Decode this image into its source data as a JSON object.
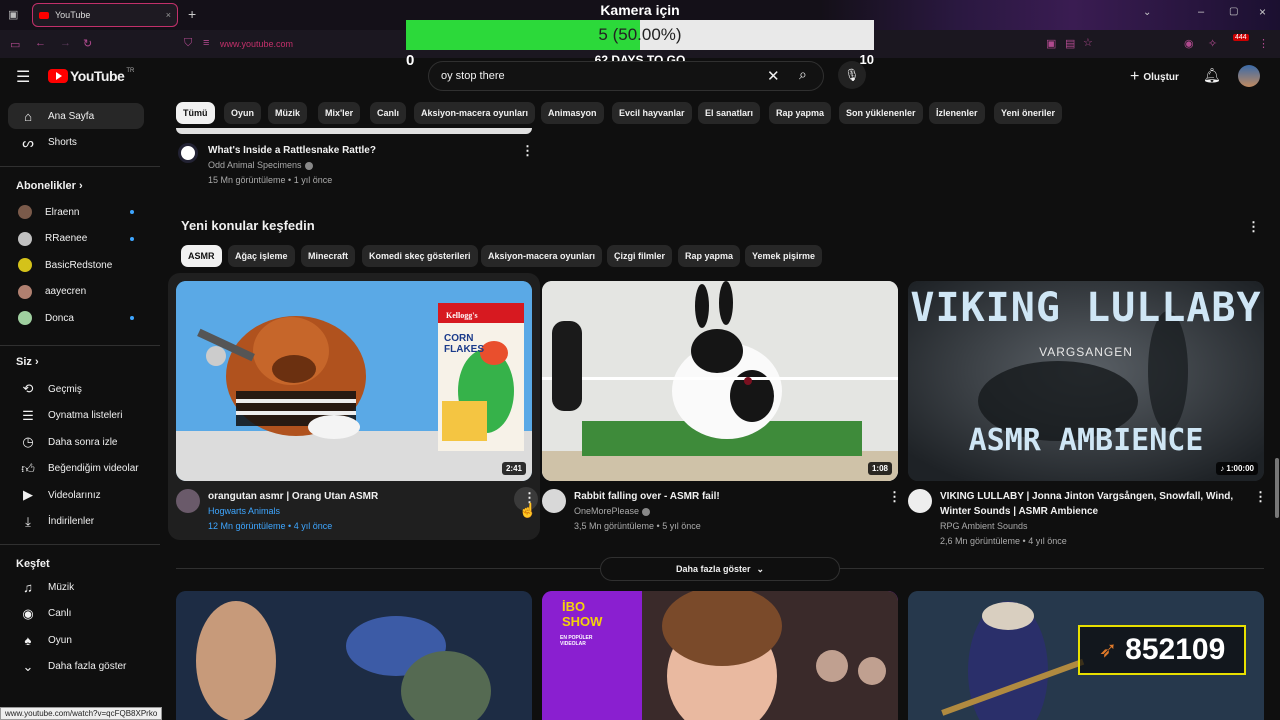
{
  "browser": {
    "tab_title": "YouTube",
    "url": "www.youtube.com",
    "badge_count": "444"
  },
  "overlay": {
    "title": "Kamera için",
    "progress_text": "5 (50.00%)",
    "progress_fraction": 0.5,
    "min": "0",
    "max": "10",
    "days_left": "62 DAYS TO GO"
  },
  "header": {
    "logo_text": "YouTube",
    "logo_sup": "TR",
    "search_value": "oy stop there",
    "create_label": "Oluştur"
  },
  "sidebar": {
    "main": [
      {
        "label": "Ana Sayfa",
        "icon": "home-icon"
      },
      {
        "label": "Shorts",
        "icon": "shorts-icon"
      }
    ],
    "subs_title": "Abonelikler",
    "subs": [
      {
        "label": "Elraenn",
        "color": "#7a5a4a",
        "live": true
      },
      {
        "label": "RRaenee",
        "color": "#c0c0c0",
        "live": true
      },
      {
        "label": "BasicRedstone",
        "color": "#d4c21a",
        "live": false
      },
      {
        "label": "aayecren",
        "color": "#b08070",
        "live": false
      },
      {
        "label": "Donca",
        "color": "#a0d0a0",
        "live": true
      }
    ],
    "you_title": "Siz",
    "you": [
      {
        "label": "Geçmiş",
        "icon": "history-icon"
      },
      {
        "label": "Oynatma listeleri",
        "icon": "playlists-icon"
      },
      {
        "label": "Daha sonra izle",
        "icon": "watch-later-icon"
      },
      {
        "label": "Beğendiğim videolar",
        "icon": "liked-icon"
      },
      {
        "label": "Videolarınız",
        "icon": "your-videos-icon"
      },
      {
        "label": "İndirilenler",
        "icon": "downloads-icon"
      }
    ],
    "explore_title": "Keşfet",
    "explore": [
      {
        "label": "Müzik",
        "icon": "music-icon"
      },
      {
        "label": "Canlı",
        "icon": "live-icon"
      },
      {
        "label": "Oyun",
        "icon": "gaming-icon"
      },
      {
        "label": "Daha fazla göster",
        "icon": "chevron-down-icon"
      }
    ]
  },
  "chips": [
    "Tümü",
    "Oyun",
    "Müzik",
    "Mix'ler",
    "Canlı",
    "Aksiyon-macera oyunları",
    "Animasyon",
    "Evcil hayvanlar",
    "El sanatları",
    "Rap yapma",
    "Son yüklenenler",
    "İzlenenler",
    "Yeni öneriler"
  ],
  "top_video": {
    "title": "What's Inside a Rattlesnake Rattle?",
    "channel": "Odd Animal Specimens",
    "meta": "15 Mn görüntüleme • 1 yıl önce"
  },
  "section": {
    "title": "Yeni konular keşfedin",
    "chips": [
      "ASMR",
      "Ağaç işleme",
      "Minecraft",
      "Komedi skeç gösterileri",
      "Aksiyon-macera oyunları",
      "Çizgi filmler",
      "Rap yapma",
      "Yemek pişirme"
    ],
    "videos": [
      {
        "title": "orangutan asmr | Orang Utan ASMR",
        "title2": "",
        "channel": "Hogwarts Animals",
        "meta": "12 Mn görüntüleme • 4 yıl önce",
        "duration": "2:41"
      },
      {
        "title": "Rabbit falling over - ASMR fail!",
        "title2": "",
        "channel": "OneMorePlease",
        "meta": "3,5 Mn görüntüleme • 5 yıl önce",
        "duration": "1:08"
      },
      {
        "title": "VIKING LULLABY | Jonna Jinton Vargsången, Snowfall, Wind,",
        "title2": "Winter Sounds | ASMR Ambience",
        "channel": "RPG Ambient Sounds",
        "meta": "2,6 Mn görüntüleme • 4 yıl önce",
        "duration": "1:00:00"
      }
    ],
    "show_more": "Daha fazla göster"
  },
  "thumb_text": {
    "cereal_brand": "Kellogg's",
    "cereal_name": "CORN FLAKES",
    "viking_title": "VIKING LULLABY",
    "viking_sub": "VARGSANGEN",
    "viking_bottom": "ASMR AMBIENCE",
    "ibo_title": "İBO SHOW",
    "ibo_sub": "EN POPÜLER VIDEOLAR",
    "game_score": "852109"
  },
  "status_url": "www.youtube.com/watch?v=qcFQB8XPrko"
}
